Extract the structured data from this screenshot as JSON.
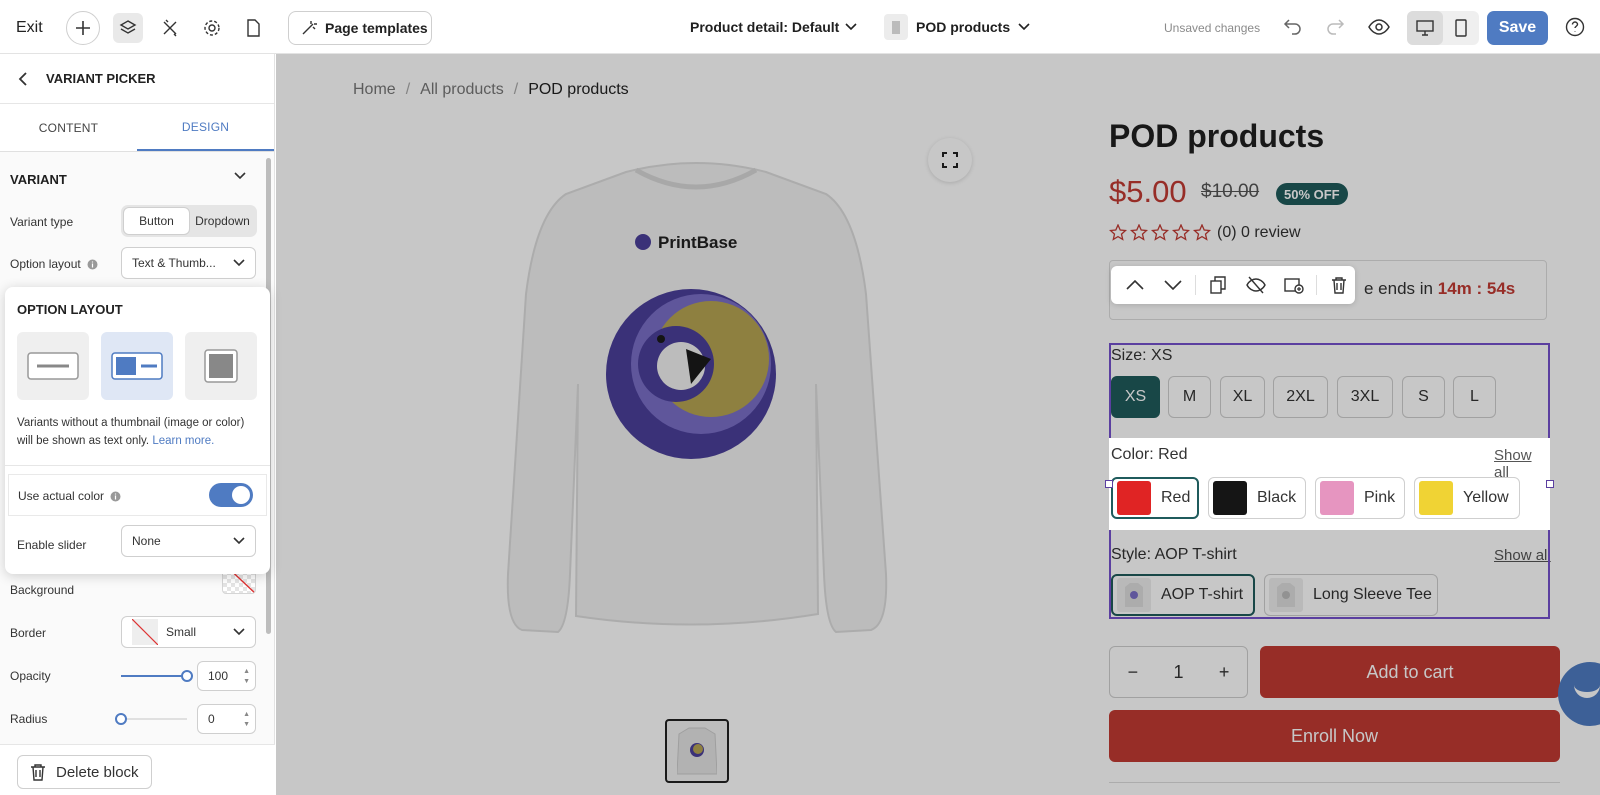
{
  "topbar": {
    "exit_label": "Exit",
    "page_templates_label": "Page templates",
    "page_selector_label": "Product detail: Default",
    "product_selector_label": "POD products",
    "unsaved_label": "Unsaved changes",
    "save_label": "Save"
  },
  "sidebar": {
    "header_title": "VARIANT PICKER",
    "tabs": [
      "CONTENT",
      "DESIGN"
    ],
    "active_tab": "DESIGN",
    "section_title": "VARIANT",
    "variant_type_label": "Variant type",
    "variant_type_options": [
      "Button",
      "Dropdown"
    ],
    "variant_type_selected": "Button",
    "option_layout_label": "Option layout",
    "option_layout_value": "Text & Thumb...",
    "background_label": "Background",
    "border_label": "Border",
    "border_value": "Small",
    "opacity_label": "Opacity",
    "opacity_value": "100",
    "radius_label": "Radius",
    "radius_value": "0",
    "delete_label": "Delete block"
  },
  "popup": {
    "title": "OPTION LAYOUT",
    "description": "Variants without a thumbnail (image or color) will be shown as text only.",
    "learn_more": "Learn more.",
    "use_actual_color_label": "Use actual color",
    "use_actual_color_on": true,
    "enable_slider_label": "Enable slider",
    "enable_slider_value": "None",
    "selected_layout_index": 1
  },
  "canvas": {
    "breadcrumbs": [
      "Home",
      "All products",
      "POD products"
    ],
    "shirt_brand": "PrintBase",
    "product_title": "POD products",
    "price": "$5.00",
    "compare_price": "$10.00",
    "discount_badge": "50% OFF",
    "rating_count": "(0) 0 review",
    "sale_text_prefix": "e ends in",
    "sale_timer": "14m : 54s",
    "size_label": "Size: XS",
    "sizes": [
      "XS",
      "M",
      "XL",
      "2XL",
      "3XL",
      "S",
      "L"
    ],
    "size_selected": "XS",
    "color_label": "Color: Red",
    "show_all": "Show all",
    "colors": [
      {
        "name": "Red",
        "hex": "#e02424"
      },
      {
        "name": "Black",
        "hex": "#151515"
      },
      {
        "name": "Pink",
        "hex": "#e695c0"
      },
      {
        "name": "Yellow",
        "hex": "#f0d334"
      }
    ],
    "color_selected": "Red",
    "style_label": "Style: AOP T-shirt",
    "styles": [
      "AOP T-shirt",
      "Long Sleeve Tee"
    ],
    "style_selected": "AOP T-shirt",
    "quantity": "1",
    "qty_minus": "−",
    "qty_plus": "+",
    "add_to_cart": "Add to cart",
    "enroll_now": "Enroll Now"
  },
  "colors": {
    "accent": "#4f7bc2",
    "price_red": "#c23a33",
    "teal": "#1f5b5c",
    "selection_purple": "#5b3fa0"
  }
}
